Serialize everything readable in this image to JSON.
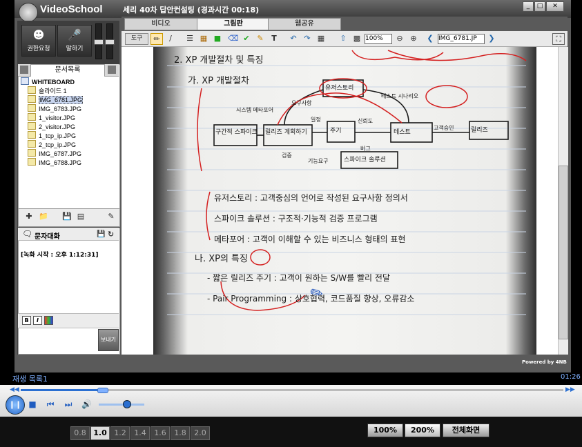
{
  "app": {
    "logo": "VideoSchool",
    "title": "세리 40차 답안컨설팅 (경과시간 00:18)",
    "window_buttons": [
      "_",
      "□",
      "✕"
    ],
    "powered": "Powered by 4NB"
  },
  "left": {
    "request_button": "권한요청",
    "speak_button": "말하기",
    "doc_tab": "문서목록",
    "tree_root": "WHITEBOARD",
    "tree_items": [
      "슬라이드 1",
      "IMG_6781.JPG",
      "IMG_6783.JPG",
      "1_visitor.JPG",
      "2_visitor.JPG",
      "1_tcp_ip.JPG",
      "2_tcp_ip.JPG",
      "IMG_6787.JPG",
      "IMG_6788.JPG"
    ],
    "selected_index": 1,
    "chat_title": "문자대화",
    "chat_log": "[녹화 시작 : 오후 1:12:31]",
    "send_button": "보내기",
    "format_buttons": [
      "B",
      "I"
    ]
  },
  "tabs": [
    "비디오",
    "그림판",
    "웹공유"
  ],
  "active_tab": 1,
  "draw_toolbar": {
    "tool_label": "도구",
    "zoom": "100%",
    "file": "IMG_6781.JP"
  },
  "notebook": {
    "heading": "2.  XP 개발절차 및 특징",
    "sub": "가.  XP 개발절차",
    "diagram_nodes": [
      "구간적 스파이크",
      "릴리즈 계획하기",
      "주기",
      "테스트",
      "릴리즈",
      "유저스토리",
      "스파이크 솔루션"
    ],
    "diagram_labels": [
      "시스템 메타포어",
      "요구사항",
      "테스트 시나리오",
      "일정",
      "신뢰도",
      "버그",
      "고객승인",
      "검증",
      "기능요구"
    ],
    "bullets": [
      "유저스토리 : 고객중심의 언어로 작성된 요구사항 정의서",
      "스파이크 솔루션 : 구조적·기능적 검증 프로그램",
      "메타포어 : 고객이 이해할 수 있는 비즈니스 형태의 표현"
    ],
    "sub2": "나.  XP의 특징",
    "bullets2": [
      "- 짧은 릴리즈 주기 : 고객이 원하는 S/W를 빨리 전달",
      "- Pair Programming : 상호협력, 코드품질 향상, 오류감소"
    ]
  },
  "player": {
    "playlist": "재생 목록1",
    "time": "01:26",
    "progress": 0.15,
    "volume": 0.6,
    "speeds": [
      "0.8",
      "1.0",
      "1.2",
      "1.4",
      "1.6",
      "1.8",
      "2.0"
    ],
    "active_speed": 1,
    "zoom_buttons": [
      "100%",
      "200%",
      "전체화면"
    ],
    "active_zoom": 1
  },
  "colors": {
    "accent": "#2a6fd1",
    "ink": "#1a1a1a",
    "marker": "#d42020"
  }
}
